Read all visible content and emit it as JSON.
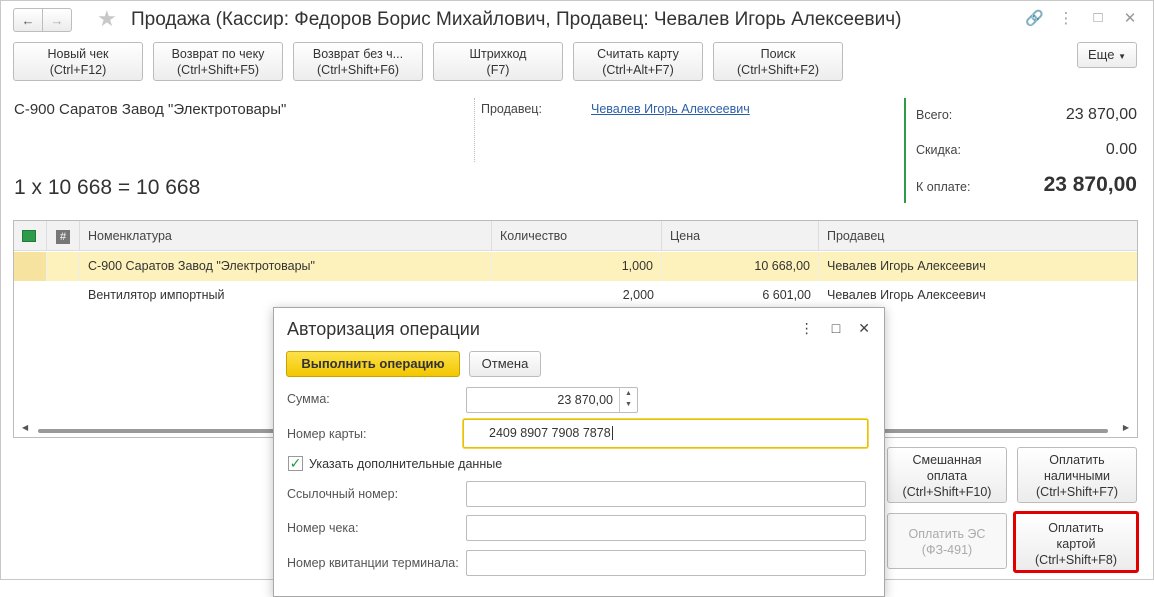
{
  "window": {
    "title": "Продажа (Кассир: Федоров Борис Михайлович, Продавец: Чевалев Игорь Алексеевич)"
  },
  "toolbar": {
    "buttons": [
      {
        "line1": "Новый чек",
        "line2": "(Ctrl+F12)"
      },
      {
        "line1": "Возврат по чеку",
        "line2": "(Ctrl+Shift+F5)"
      },
      {
        "line1": "Возврат без ч...",
        "line2": "(Ctrl+Shift+F6)"
      },
      {
        "line1": "Штрихкод",
        "line2": "(F7)"
      },
      {
        "line1": "Считать карту",
        "line2": "(Ctrl+Alt+F7)"
      },
      {
        "line1": "Поиск",
        "line2": "(Ctrl+Shift+F2)"
      }
    ],
    "more_label": "Еще"
  },
  "current_item": {
    "name": "С-900 Саратов Завод \"Электротовары\"",
    "formula": "1 x 10 668 = 10 668",
    "seller_label": "Продавец:",
    "seller_name": "Чевалев Игорь Алексеевич"
  },
  "totals": {
    "total_label": "Всего:",
    "total_value": "23 870,00",
    "discount_label": "Скидка:",
    "discount_value": "0.00",
    "topay_label": "К оплате:",
    "topay_value": "23 870,00"
  },
  "table": {
    "columns": [
      "Номенклатура",
      "Количество",
      "Цена",
      "Продавец"
    ],
    "hash_header": "#",
    "rows": [
      {
        "name": "С-900 Саратов Завод \"Электротовары\"",
        "qty": "1,000",
        "price": "10 668,00",
        "seller": "Чевалев Игорь Алексеевич"
      },
      {
        "name": "Вентилятор импортный",
        "qty": "2,000",
        "price": "6 601,00",
        "seller": "Чевалев Игорь Алексеевич"
      }
    ]
  },
  "payment_buttons": {
    "mixed": {
      "line1": "Смешанная",
      "line2": "оплата",
      "line3": "(Ctrl+Shift+F10)"
    },
    "cash": {
      "line1": "Оплатить",
      "line2": "наличными",
      "line3": "(Ctrl+Shift+F7)"
    },
    "es": {
      "line1": "Оплатить ЭС",
      "line2": "(ФЗ-491)"
    },
    "card": {
      "line1": "Оплатить",
      "line2": "картой",
      "line3": "(Ctrl+Shift+F8)"
    }
  },
  "dialog": {
    "title": "Авторизация операции",
    "execute_label": "Выполнить операцию",
    "cancel_label": "Отмена",
    "sum_label": "Сумма:",
    "sum_value": "23 870,00",
    "card_label": "Номер карты:",
    "card_value": "2409 8907 7908 7878",
    "additional_label": "Указать дополнительные данные",
    "additional_checked": true,
    "ref_label": "Ссылочный номер:",
    "ref_value": "",
    "check_label": "Номер чека:",
    "check_value": "",
    "receipt_label": "Номер квитанции терминала:",
    "receipt_value": ""
  },
  "colors": {
    "accent_green": "#2e9a4a",
    "selected_row": "#fdf2bc",
    "primary_button": "#f2c600",
    "highlight_red": "#e00000",
    "link": "#2c5ea8"
  }
}
